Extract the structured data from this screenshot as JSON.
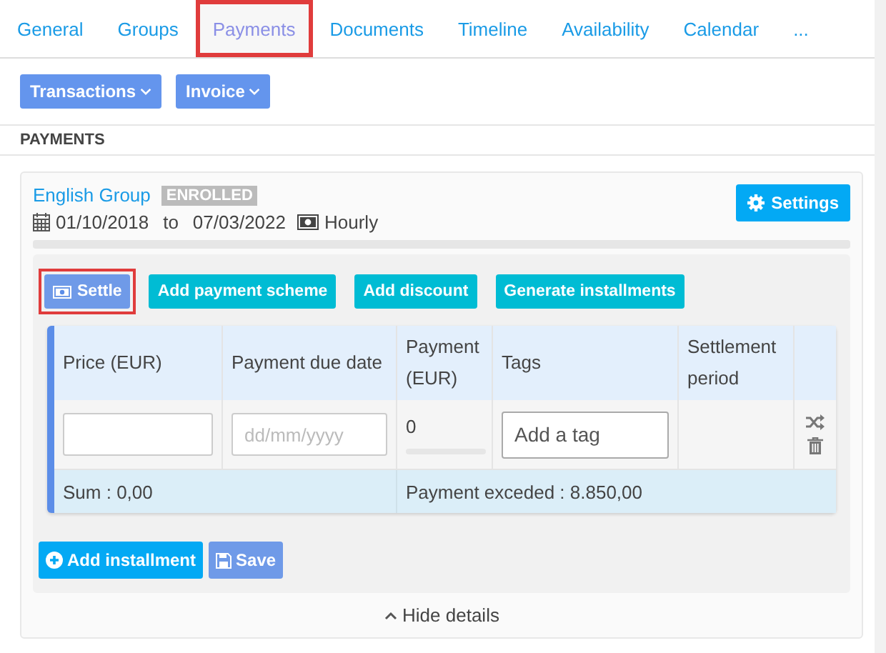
{
  "tabs": [
    {
      "label": "General",
      "selected": false,
      "highlighted": false
    },
    {
      "label": "Groups",
      "selected": false,
      "highlighted": false
    },
    {
      "label": "Payments",
      "selected": true,
      "highlighted": true
    },
    {
      "label": "Documents",
      "selected": false,
      "highlighted": false
    },
    {
      "label": "Timeline",
      "selected": false,
      "highlighted": false
    },
    {
      "label": "Availability",
      "selected": false,
      "highlighted": false
    },
    {
      "label": "Calendar",
      "selected": false,
      "highlighted": false
    },
    {
      "label": "...",
      "selected": false,
      "highlighted": false
    }
  ],
  "toolbar": [
    "Transactions",
    "Invoice"
  ],
  "section_title": "PAYMENTS",
  "enrollment": {
    "group": "English Group",
    "status": "ENROLLED",
    "start": "01/10/2018",
    "to": "to",
    "end": "07/03/2022",
    "rate": "Hourly",
    "settings": "Settings"
  },
  "actions": [
    {
      "label": "Settle",
      "kind": "primary",
      "highlighted": true
    },
    {
      "label": "Add payment scheme",
      "kind": "info",
      "highlighted": false
    },
    {
      "label": "Add discount",
      "kind": "info",
      "highlighted": false
    },
    {
      "label": "Generate installments",
      "kind": "info",
      "highlighted": false
    }
  ],
  "table": {
    "columns": [
      "Price (EUR)",
      "Payment due date",
      "Payment (EUR)",
      "Tags",
      "Settlement period"
    ],
    "row": {
      "due_date_placeholder": "dd/mm/yyyy",
      "payment": {
        "value": "0",
        "level": 0
      },
      "tags_placeholder": "Add a tag"
    },
    "sum": "Sum : 0,00",
    "exceeded": "Payment exceded : 8.850,00"
  },
  "footer_buttons": [
    {
      "label": "Add installment",
      "kind": "add"
    },
    {
      "label": "Save",
      "kind": "save"
    }
  ],
  "toggle": "Hide details"
}
